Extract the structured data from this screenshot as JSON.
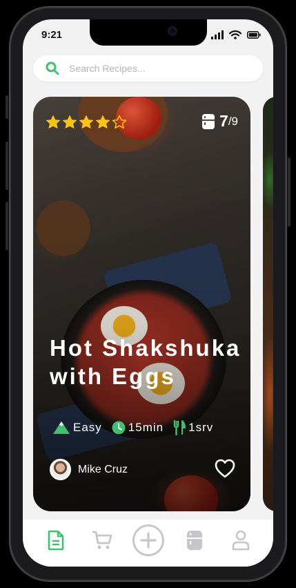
{
  "status_bar": {
    "time": "9:21"
  },
  "search": {
    "placeholder": "Search Recipes..."
  },
  "recipe_card": {
    "rating": 4,
    "rating_max": 5,
    "page_current": "7",
    "page_total": "/9",
    "title": "Hot Shakshuka with Eggs",
    "difficulty": "Easy",
    "time": "15min",
    "servings": "1srv",
    "author": "Mike Cruz"
  },
  "tab_bar": {
    "items": [
      "recipes-tab",
      "cart-tab",
      "add-button",
      "fridge-tab",
      "profile-tab"
    ],
    "active": "recipes-tab"
  },
  "colors": {
    "accent_green": "#3fbf6f",
    "star_yellow": "#f7c21b",
    "inactive_icon": "#c5c5ca"
  }
}
